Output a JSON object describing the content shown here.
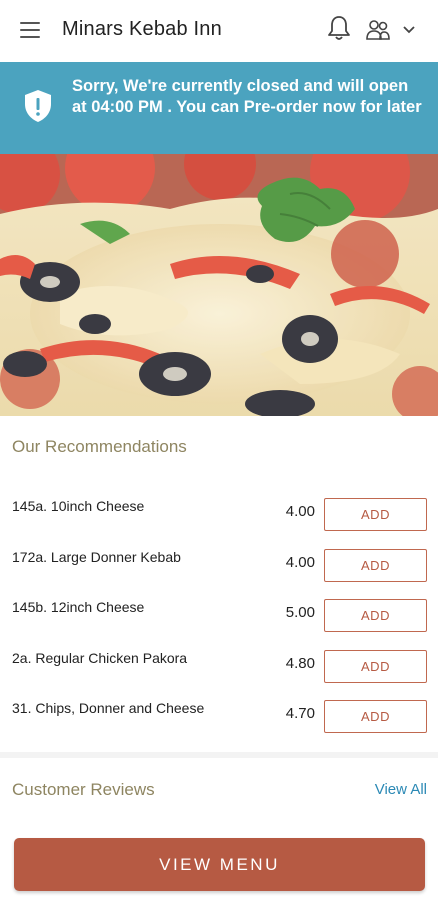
{
  "header": {
    "title": "Minars Kebab Inn",
    "menu_icon": "hamburger-menu-icon",
    "notification_icon": "bell-icon",
    "user_icon": "user-group-icon",
    "dropdown_icon": "chevron-down-icon"
  },
  "banner": {
    "icon": "shield-alert-icon",
    "message": "Sorry, We're currently closed and will open at 04:00 PM . You can Pre-order now for later",
    "color": "#4ba3bf"
  },
  "hero": {
    "description": "pizza-image"
  },
  "recommendations": {
    "title": "Our Recommendations",
    "items": [
      {
        "name": "145a. 10inch Cheese",
        "price": "4.00",
        "button": "ADD"
      },
      {
        "name": "172a. Large Donner Kebab",
        "price": "4.00",
        "button": "ADD"
      },
      {
        "name": "145b. 12inch Cheese",
        "price": "5.00",
        "button": "ADD"
      },
      {
        "name": "2a. Regular Chicken Pakora",
        "price": "4.80",
        "button": "ADD"
      },
      {
        "name": "31. Chips, Donner and Cheese",
        "price": "4.70",
        "button": "ADD"
      }
    ]
  },
  "reviews": {
    "title": "Customer Reviews",
    "view_all": "View All"
  },
  "footer": {
    "button": "VIEW MENU",
    "color": "#b65a43"
  }
}
